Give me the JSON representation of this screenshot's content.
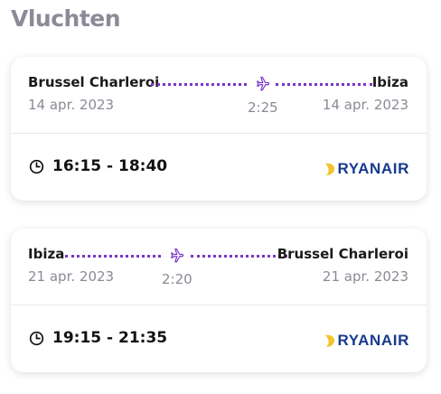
{
  "page": {
    "title": "Vluchten"
  },
  "colors": {
    "route_line": "#7a35c8",
    "airline_text": "#173a8f",
    "harp": "#f4c430"
  },
  "flights": [
    {
      "origin": "Brussel Charleroi",
      "destination": "Ibiza",
      "departure_date": "14 apr. 2023",
      "arrival_date": "14 apr. 2023",
      "duration": "2:25",
      "times": "16:15 - 18:40",
      "airline": "RYANAIR",
      "icons": [
        "plane-icon",
        "clock-icon",
        "ryanair-harp-logo"
      ]
    },
    {
      "origin": "Ibiza",
      "destination": "Brussel Charleroi",
      "departure_date": "21 apr. 2023",
      "arrival_date": "21 apr. 2023",
      "duration": "2:20",
      "times": "19:15 - 21:35",
      "airline": "RYANAIR",
      "icons": [
        "plane-icon",
        "clock-icon",
        "ryanair-harp-logo"
      ]
    }
  ]
}
